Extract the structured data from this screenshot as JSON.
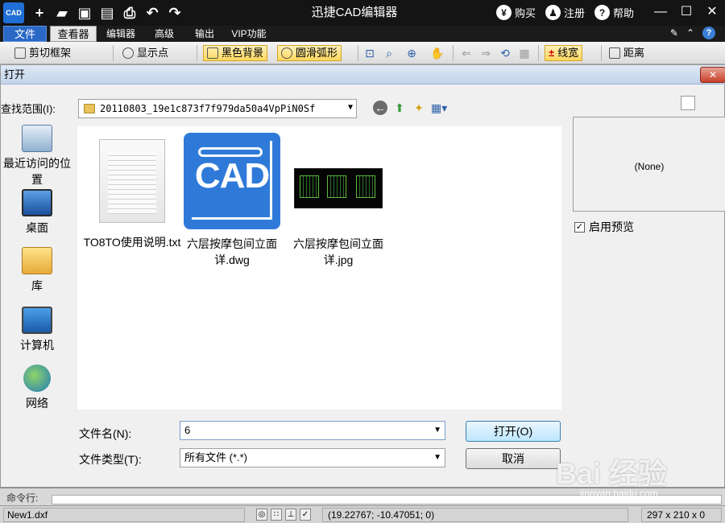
{
  "titlebar": {
    "logo": "CAD",
    "title": "迅捷CAD编辑器",
    "actions": [
      {
        "icon": "yen-icon",
        "glyph": "¥",
        "label": "购买"
      },
      {
        "icon": "user-icon",
        "glyph": "♟",
        "label": "注册"
      },
      {
        "icon": "help-icon",
        "glyph": "?",
        "label": "帮助"
      }
    ]
  },
  "menu": {
    "tabs": [
      "文件",
      "查看器",
      "编辑器",
      "高级",
      "输出",
      "VIP功能"
    ]
  },
  "ribbon": {
    "clip_frame": "剪切框架",
    "show_points": "显示点",
    "black_bg": "黑色背景",
    "smooth_arc": "圆滑弧形",
    "line_width": "线宽",
    "distance": "距离"
  },
  "dialog": {
    "title": "打开",
    "lookin_label": "查找范围(I):",
    "lookin_value": "20110803_19e1c873f7f979da50a4VpPiN0Sf",
    "places": [
      "最近访问的位置",
      "桌面",
      "库",
      "计算机",
      "网络"
    ],
    "files": [
      {
        "name": "TO8TO使用说明.txt",
        "icon": "text-file-icon"
      },
      {
        "name": "六层按摩包间立面详.dwg",
        "icon": "cad-file-icon"
      },
      {
        "name": "六层按摩包间立面详.jpg",
        "icon": "image-file-icon"
      }
    ],
    "preview_text": "(None)",
    "enable_preview": "启用预览",
    "filename_label": "文件名(N):",
    "filename_value": "6",
    "filetype_label": "文件类型(T):",
    "filetype_value": "所有文件 (*.*)",
    "open_button": "打开(O)",
    "cancel_button": "取消"
  },
  "command": {
    "label": "命令行:"
  },
  "status": {
    "file": "New1.dxf",
    "coords": "(19.22767; -10.47051; 0)",
    "size": "297 x 210 x 0"
  },
  "watermark": {
    "text": "Bai 经验",
    "sub": "jingyan.baidu.com"
  }
}
